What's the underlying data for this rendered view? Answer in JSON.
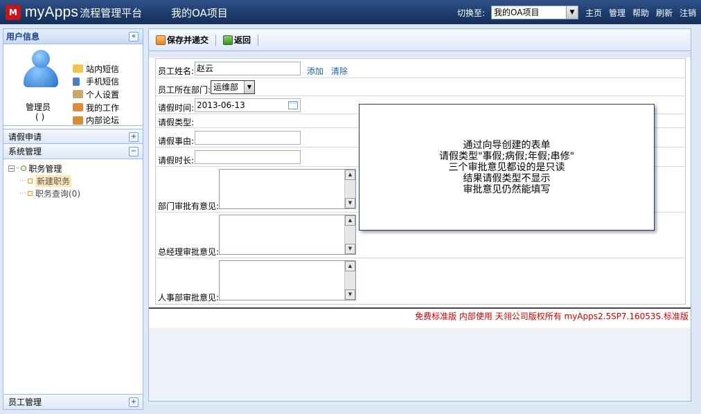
{
  "header": {
    "logo_mark": "M",
    "logo_text": "myApps",
    "logo_sub": "流程管理平台",
    "project_title": "我的OA项目",
    "switch_label": "切换至:",
    "switch_value": "我的OA项目",
    "links": [
      "主页",
      "管理",
      "帮助",
      "刷新",
      "注销"
    ]
  },
  "sidebar": {
    "user_panel_title": "用户信息",
    "user_name": "管理员",
    "user_role": "( )",
    "user_links": [
      {
        "label": "站内短信",
        "icon": "mail-icon",
        "color": "#e8b93a"
      },
      {
        "label": "手机短信",
        "icon": "mobile-icon",
        "color": "#4b7fbf"
      },
      {
        "label": "个人设置",
        "icon": "edit-icon",
        "color": "#9b7a3a"
      },
      {
        "label": "我的工作",
        "icon": "work-icon",
        "color": "#d9732c"
      },
      {
        "label": "内部论坛",
        "icon": "home-icon",
        "color": "#c9822a"
      }
    ],
    "sections": [
      {
        "label": "请假申请",
        "state": "+"
      },
      {
        "label": "系统管理",
        "state": "−"
      }
    ],
    "tree": {
      "root": "职务管理",
      "children": [
        {
          "label": "新建职务",
          "selected": true
        },
        {
          "label": "职务查询(0)",
          "selected": false
        }
      ]
    },
    "bottom_section": "员工管理"
  },
  "toolbar": {
    "save_label": "保存并递交",
    "back_label": "返回"
  },
  "form": {
    "name_label": "员工姓名:",
    "name_value": "赵云",
    "add_link": "添加",
    "clear_link": "清除",
    "dept_label": "员工所在部门:",
    "dept_value": "运维部",
    "date_label": "请假时间:",
    "date_value": "2013-06-13",
    "type_label": "请假类型:",
    "reason_label": "请假事由:",
    "duration_label": "请假时长:",
    "dept_opinion_label": "部门审批有意见:",
    "gm_opinion_label": "总经理审批意见:",
    "hr_opinion_label": "人事部审批意见:"
  },
  "footer": {
    "text": "免费标准版  内部使用  天翎公司版权所有  myApps2.5SP7.16053S.标准版"
  },
  "note": {
    "lines": [
      "通过向导创建的表单",
      "请假类型\"事假;病假;年假;串修\"",
      "三个审批意见都设的是只读",
      "结果请假类型不显示",
      "审批意见仍然能填写"
    ]
  }
}
